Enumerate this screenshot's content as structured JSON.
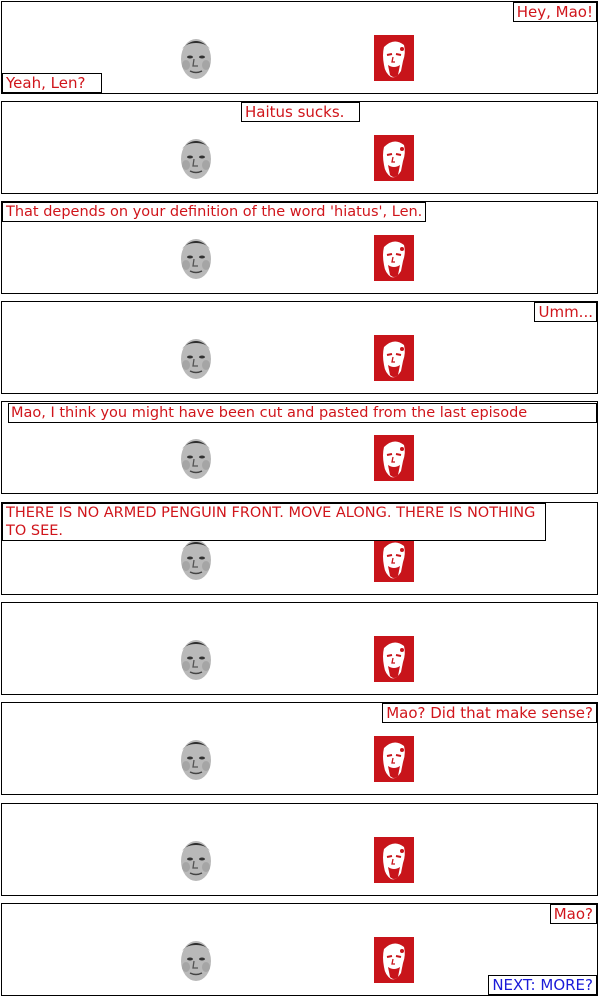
{
  "panels": [
    {
      "bubbles": [
        "Hey, Mao!",
        "Yeah, Len?"
      ]
    },
    {
      "bubbles": [
        "Haitus sucks."
      ]
    },
    {
      "bubbles": [
        "That depends on your definition of the word 'hiatus', Len."
      ]
    },
    {
      "bubbles": [
        "Umm..."
      ]
    },
    {
      "bubbles": [
        "Mao, I think you might have been cut and pasted from the last episode"
      ]
    },
    {
      "bubbles": [
        "THERE IS NO ARMED PENGUIN FRONT.  MOVE ALONG.  THERE IS NOTHING TO SEE."
      ]
    },
    {
      "bubbles": []
    },
    {
      "bubbles": [
        "Mao?  Did that make sense?"
      ]
    },
    {
      "bubbles": []
    },
    {
      "bubbles": [
        "Mao?"
      ]
    }
  ],
  "nav": {
    "next_label": "NEXT: MORE?"
  },
  "colors": {
    "dialogue": "#d0151b",
    "link": "#1a1ad8",
    "lenin_bg": "#c8141a"
  }
}
